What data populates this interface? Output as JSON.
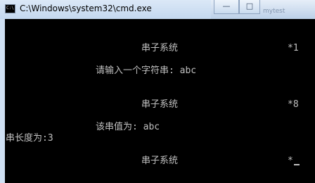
{
  "window": {
    "title": "C:\\Windows\\system32\\cmd.exe",
    "icon_name": "cmd-icon",
    "icon_text": "C:\\",
    "background_app_label": "mytest"
  },
  "caption": {
    "minimize_icon": "minimize-icon",
    "maximize_icon": "maximize-icon",
    "close_icon": "close-icon"
  },
  "console": {
    "lines": [
      "串子系统",
      "*1",
      "请输入一个字符串: abc",
      "串子系统",
      "*8",
      "该串值为: abc",
      "串长度为:3",
      "串子系统",
      "*"
    ],
    "colors": {
      "background": "#000000",
      "text": "#c0c0c0"
    }
  }
}
